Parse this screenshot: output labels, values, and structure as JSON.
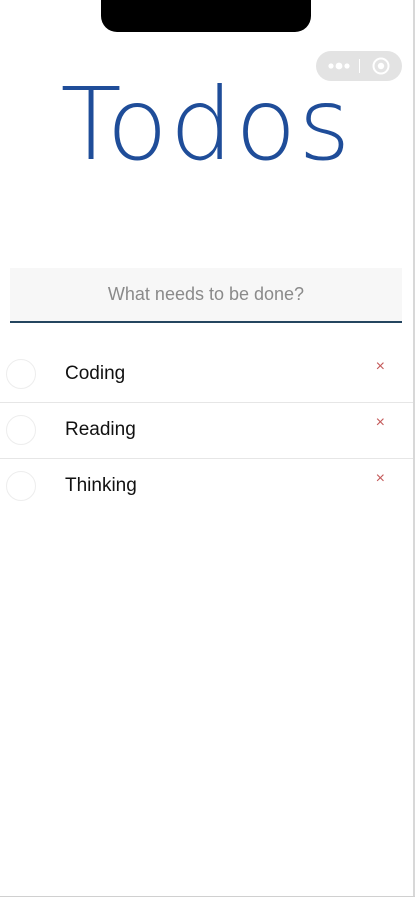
{
  "app": {
    "title": "Todos"
  },
  "new_todo": {
    "placeholder": "What needs to be done?"
  },
  "todos": [
    {
      "label": "Coding",
      "completed": false
    },
    {
      "label": "Reading",
      "completed": false
    },
    {
      "label": "Thinking",
      "completed": false
    }
  ],
  "destroy_symbol": "×",
  "colors": {
    "title": "#1f4d99",
    "input_underline": "#24455f",
    "destroy": "#c45a5a"
  },
  "icons": {
    "capsule_menu": "more-dots-icon",
    "capsule_close": "target-close-icon"
  }
}
